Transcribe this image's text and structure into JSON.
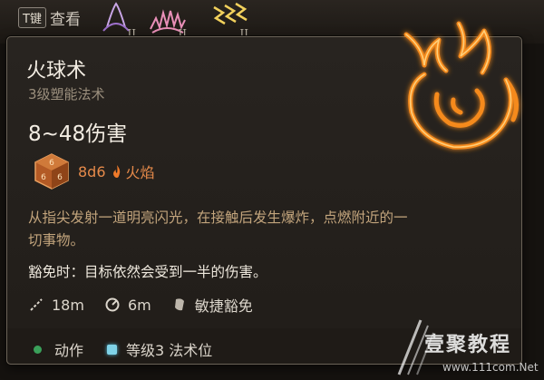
{
  "topbar": {
    "key_label": "T键",
    "view_label": "查看",
    "slots": [
      {
        "icon": "spell-icon-purple",
        "tier": "II"
      },
      {
        "icon": "spell-icon-pink-burst",
        "tier": "II"
      },
      {
        "icon": "spell-icon-lightning",
        "tier": "II"
      }
    ]
  },
  "spell": {
    "name": "火球术",
    "school": "3级塑能法术",
    "damage_range": "8~48伤害",
    "dice": "8d6",
    "damage_type": "火焰",
    "description": "从指尖发射一道明亮闪光，在接触后发生爆炸，点燃附近的一切事物。",
    "save_text": "豁免时：目标依然会受到一半的伤害。",
    "range": "18m",
    "radius": "6m",
    "save_type": "敏捷豁免",
    "action": "动作",
    "slot_cost": "等级3 法术位"
  },
  "watermark": {
    "brand": "壹聚教程",
    "url": "www.111com.Net"
  },
  "colors": {
    "accent_orange": "#e68a4a",
    "description_text": "#c2a47c",
    "action_green": "#3aa05a",
    "slot_blue": "#7fd3e8"
  }
}
